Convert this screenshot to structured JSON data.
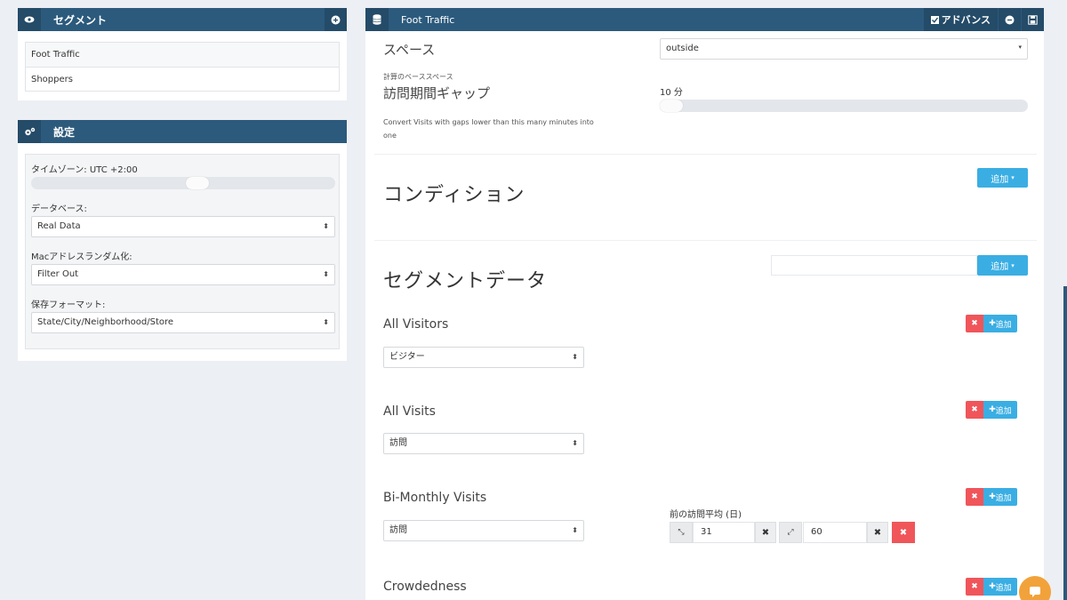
{
  "segments_panel": {
    "title": "セグメント",
    "items": [
      "Foot Traffic",
      "Shoppers"
    ]
  },
  "settings_panel": {
    "title": "設定",
    "timezone_label": "タイムゾーン: UTC +2:00",
    "timezone_slider_fraction": 0.55,
    "database_label": "データベース:",
    "database_value": "Real Data",
    "mac_label": "Macアドレスランダム化:",
    "mac_value": "Filter Out",
    "format_label": "保存フォーマット:",
    "format_value": "State/City/Neighborhood/Store"
  },
  "main_panel": {
    "title": "Foot Traffic",
    "advanced_label": "アドバンス",
    "space_label": "スペース",
    "space_value": "outside",
    "base_space_label": "計算のベーススペース",
    "gap_label": "訪問期間ギャップ",
    "gap_value": "10 分",
    "gap_slider_fraction": 0.0,
    "gap_help": "Convert Visits with gaps lower than this many minutes into one",
    "conditions_title": "コンディション",
    "add_label": "追加",
    "segment_data_title": "セグメントデータ",
    "add_small_label": "追加",
    "rows": [
      {
        "name": "All Visitors",
        "select": "ビジター"
      },
      {
        "name": "All Visits",
        "select": "訪問"
      },
      {
        "name": "Bi-Monthly Visits",
        "select": "訪問"
      },
      {
        "name": "Crowdedness"
      }
    ],
    "avg_label": "前の訪問平均 (日)",
    "avg_min": "31",
    "avg_max": "60"
  },
  "icons": {
    "eye": "eye-icon",
    "plus_circle": "plus-circle-icon",
    "cogs": "cogs-icon",
    "database": "database-icon",
    "checkbox": "checkbox-icon",
    "minus_circle": "minus-circle-icon",
    "save": "save-icon",
    "chat": "chat-icon"
  },
  "colors": {
    "header": "#2c5a7c",
    "primary": "#3aaee3",
    "danger": "#f0555a",
    "chat": "#f2a23a"
  }
}
